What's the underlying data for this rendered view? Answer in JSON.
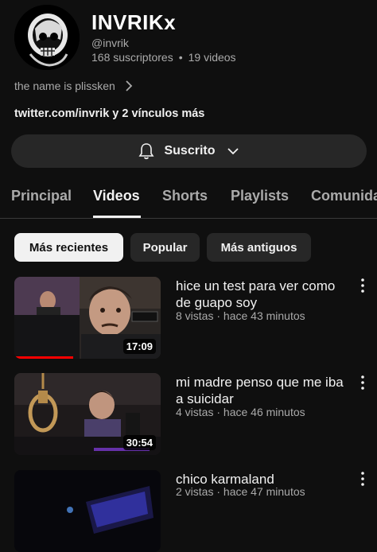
{
  "channel": {
    "name": "INVRIKx",
    "handle": "@invrik",
    "subscribers": "168 suscriptores",
    "separator": "•",
    "videos_count": "19 videos",
    "description": "the name is plissken",
    "links": "twitter.com/invrik y 2 vínculos más"
  },
  "subscribe_button": {
    "label": "Suscrito",
    "icon": "bell-icon"
  },
  "tabs": [
    {
      "label": "Principal",
      "active": false
    },
    {
      "label": "Videos",
      "active": true
    },
    {
      "label": "Shorts",
      "active": false
    },
    {
      "label": "Playlists",
      "active": false
    },
    {
      "label": "Comunidad",
      "active": false
    }
  ],
  "filters": [
    {
      "label": "Más recientes",
      "selected": true
    },
    {
      "label": "Popular",
      "selected": false
    },
    {
      "label": "Más antiguos",
      "selected": false
    }
  ],
  "videos": [
    {
      "title": "hice un test para ver como de guapo soy",
      "meta": "8 vistas · hace 43 minutos",
      "duration": "17:09",
      "watched_fraction": 0.4
    },
    {
      "title": "mi madre penso que me iba a suicidar",
      "meta": "4 vistas · hace 46 minutos",
      "duration": "30:54",
      "watched_fraction": 0
    },
    {
      "title": "chico karmaland",
      "meta": "2 vistas · hace 47 minutos",
      "duration": "",
      "watched_fraction": 0
    }
  ],
  "colors": {
    "background": "#0f0f0f",
    "chip_selected": "#f1f1f1",
    "surface": "#272727",
    "progress": "#ff0000"
  }
}
